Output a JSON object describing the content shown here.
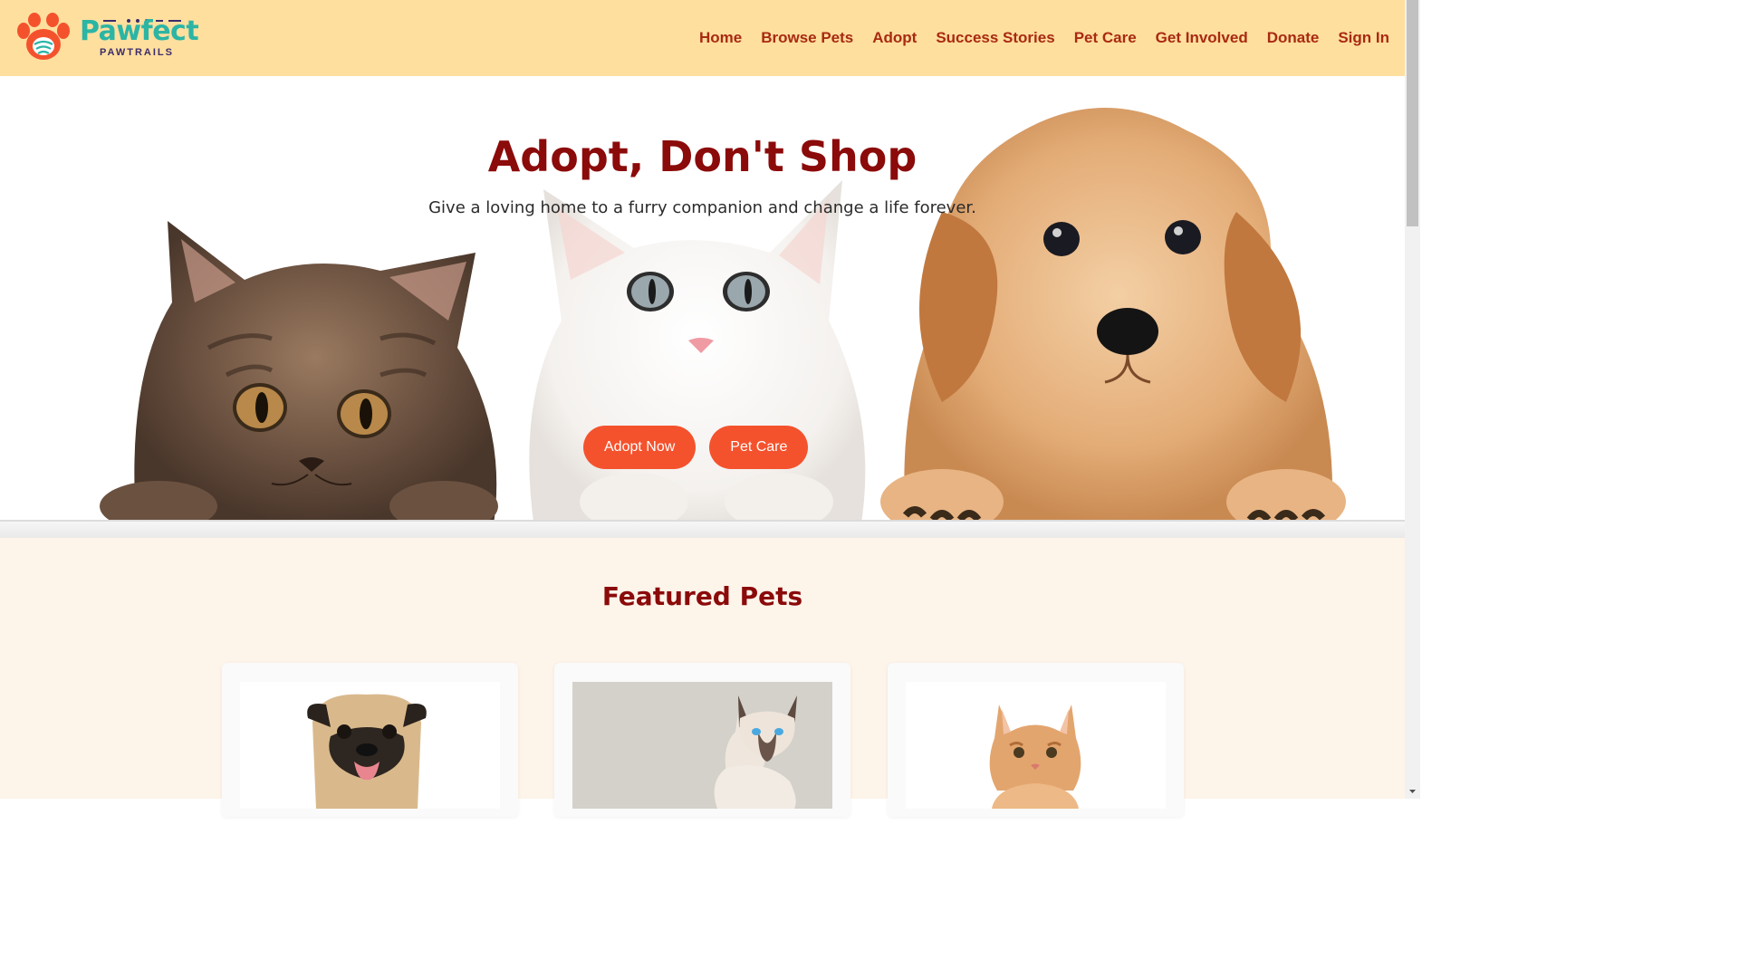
{
  "brand": {
    "name": "Pawfect",
    "tagline": "PAWTRAILS",
    "primary_color": "#2bb5a5",
    "accent_color": "#f4522d"
  },
  "nav": {
    "items": [
      {
        "label": "Home"
      },
      {
        "label": "Browse Pets"
      },
      {
        "label": "Adopt"
      },
      {
        "label": "Success Stories"
      },
      {
        "label": "Pet Care"
      },
      {
        "label": "Get Involved"
      },
      {
        "label": "Donate"
      },
      {
        "label": "Sign In"
      }
    ]
  },
  "hero": {
    "title": "Adopt, Don't Shop",
    "subtitle": "Give a loving home to a furry companion and change a life forever.",
    "primary_button": "Adopt Now",
    "secondary_button": "Pet Care",
    "image": "tabby-kitten, white-kitten, golden-puppy"
  },
  "featured": {
    "title": "Featured Pets",
    "cards": [
      {
        "image": "pug-photo"
      },
      {
        "image": "siamese-cat-photo"
      },
      {
        "image": "orange-kitten-photo"
      }
    ]
  }
}
